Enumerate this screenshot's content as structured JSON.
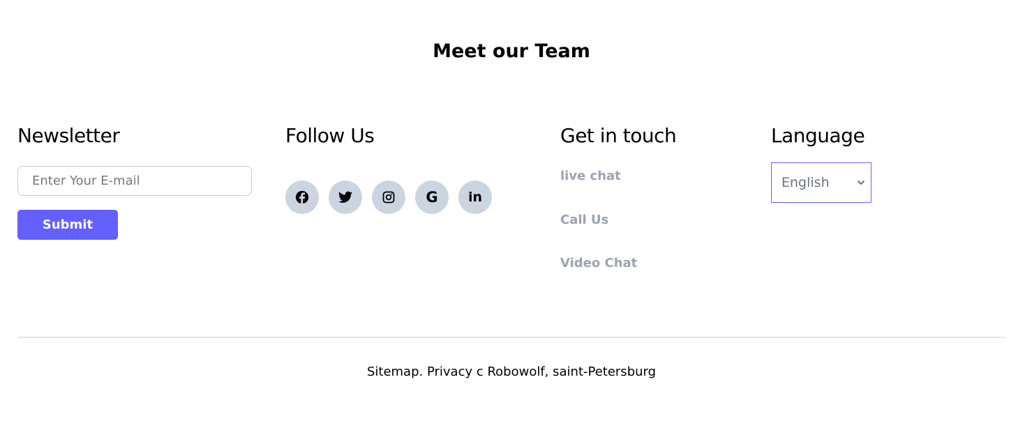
{
  "title": "Meet our Team",
  "newsletter": {
    "heading": "Newsletter",
    "email_placeholder": "Enter Your E-mail",
    "submit_label": "Submit",
    "accent": "#6360fd"
  },
  "follow": {
    "heading": "Follow Us",
    "icons": [
      "facebook-icon",
      "twitter-icon",
      "instagram-icon",
      "google-icon",
      "linkedin-icon"
    ]
  },
  "contact": {
    "heading": "Get in touch",
    "links": [
      "live chat",
      "Call Us",
      "Video Chat"
    ]
  },
  "language": {
    "heading": "Language",
    "selected": "English"
  },
  "footer": {
    "text": "Sitemap. Privacy c Robowolf, saint-Petersburg"
  }
}
